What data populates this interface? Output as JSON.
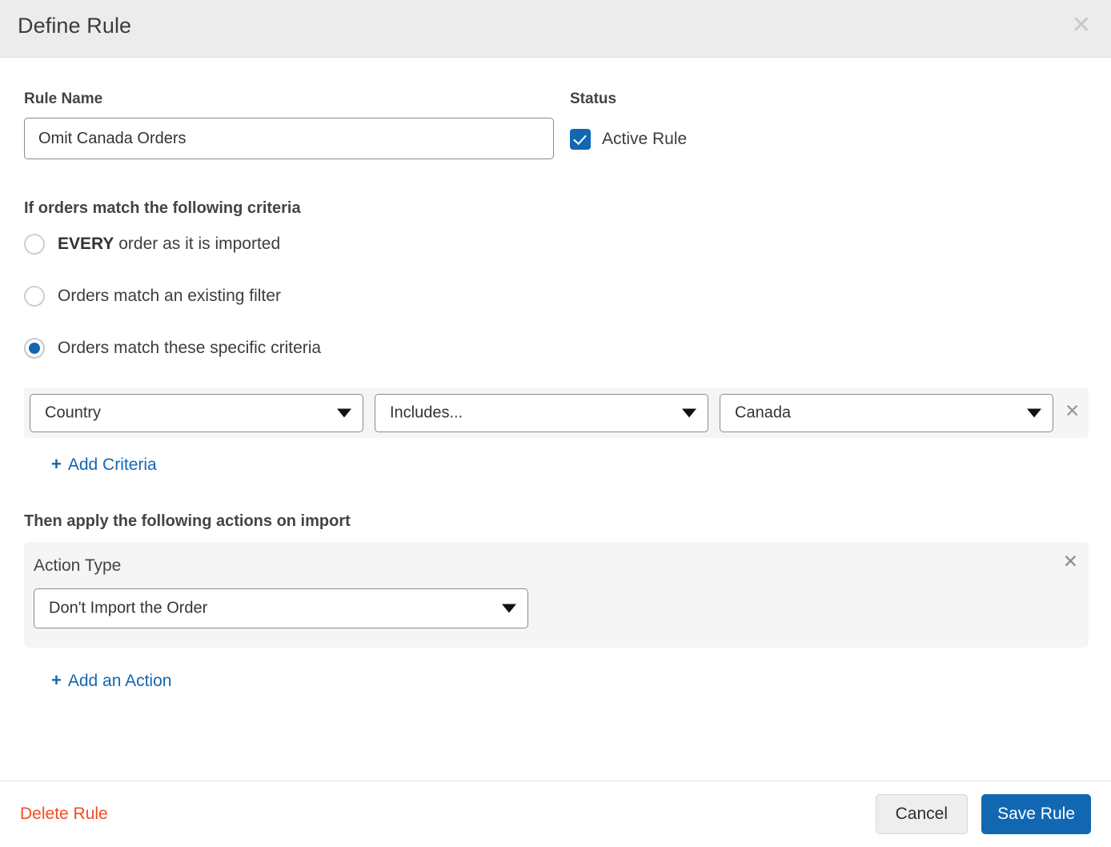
{
  "header": {
    "title": "Define Rule",
    "close_icon": "close-icon"
  },
  "form": {
    "rule_name": {
      "label": "Rule Name",
      "value": "Omit Canada Orders",
      "placeholder": "Rule Name"
    },
    "status": {
      "label": "Status",
      "active_rule_label": "Active Rule",
      "active_rule_checked": true
    }
  },
  "criteria_section": {
    "heading": "If orders match the following criteria",
    "options": [
      {
        "label_bold": "EVERY",
        "label_rest": " order as it is imported",
        "selected": false
      },
      {
        "label_bold": "",
        "label_rest": "Orders match an existing filter",
        "selected": false
      },
      {
        "label_bold": "",
        "label_rest": "Orders match these specific criteria",
        "selected": true
      }
    ],
    "rows": [
      {
        "field": "Country",
        "operator": "Includes...",
        "value": "Canada",
        "remove_icon": "✕"
      }
    ],
    "add_link": "Add Criteria",
    "plus": "+"
  },
  "actions_section": {
    "heading": "Then apply the following actions on import",
    "action_type_label": "Action Type",
    "action_type_value": "Don't Import the Order",
    "remove_icon": "✕",
    "add_link": "Add an Action",
    "plus": "+"
  },
  "footer": {
    "delete_label": "Delete Rule",
    "cancel_label": "Cancel",
    "save_label": "Save Rule"
  },
  "colors": {
    "accent": "#1267b2",
    "danger": "#f24c23",
    "header_bg": "#ececec",
    "panel_bg": "#f5f5f5"
  }
}
